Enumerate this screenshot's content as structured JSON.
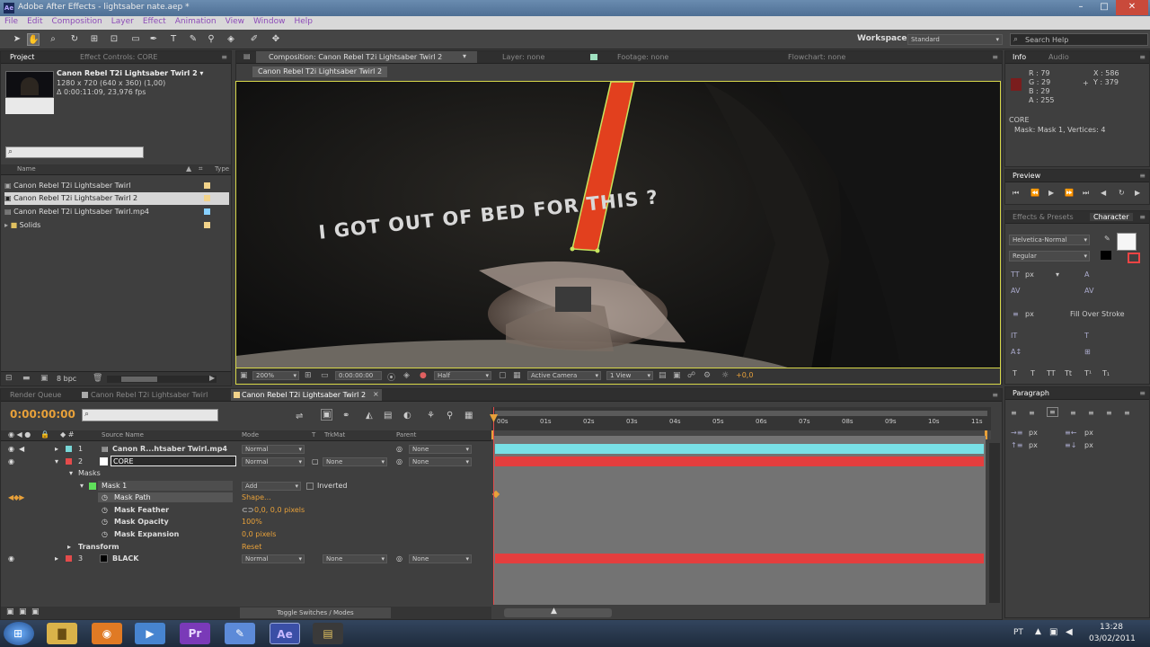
{
  "window": {
    "title": "Adobe After Effects - lightsaber nate.aep *",
    "app_icon": "Ae",
    "minimize": "–",
    "maximize": "□",
    "close": "✕"
  },
  "menu": [
    "File",
    "Edit",
    "Composition",
    "Layer",
    "Effect",
    "Animation",
    "View",
    "Window",
    "Help"
  ],
  "toolbar": {
    "workspace_label": "Workspace:",
    "workspace_value": "Standard",
    "search_placeholder": "Search Help"
  },
  "project": {
    "tab": "Project",
    "tab2": "Effect Controls: CORE",
    "comp_name": "Canon Rebel T2i Lightsaber Twirl 2 ▾",
    "comp_size": "1280 x 720  (640 x 360) (1,00)",
    "comp_duration": "Δ 0:00:11:09, 23,976 fps",
    "search_placeholder": "",
    "col_name": "Name",
    "col_type": "Type",
    "items": [
      {
        "label": "Canon Rebel T2i Lightsaber Twirl",
        "color": "#f2d38a"
      },
      {
        "label": "Canon Rebel T2i Lightsaber Twirl 2",
        "color": "#f2d38a"
      },
      {
        "label": "Canon Rebel T2i Lightsaber Twirl.mp4",
        "color": "#88d0ff"
      },
      {
        "label": "Solids",
        "color": "#f2d38a"
      }
    ],
    "bpc": "8 bpc"
  },
  "composition": {
    "tab": "Composition: Canon Rebel T2i Lightsaber Twirl 2",
    "tab_other1": "Layer: none",
    "tab_other2": "Footage: none",
    "tab_other3": "Flowchart: none",
    "breadcrumb": "Canon Rebel T2i Lightsaber Twirl 2",
    "shirt_text": "I GOT OUT OF BED FOR THIS ?",
    "zoom": "200%",
    "timecode": "0:00:00:00",
    "resolution": "Half",
    "camera": "Active Camera",
    "view": "1 View",
    "exposure": "+0,0"
  },
  "timeline": {
    "tab_render": "Render Queue",
    "tab_comp1": "Canon Rebel T2i Lightsaber Twirl",
    "tab_comp2": "Canon Rebel T2i Lightsaber Twirl 2",
    "current_time": "0:00:00:00",
    "search_placeholder": "",
    "col_source": "Source Name",
    "col_mode": "Mode",
    "col_t": "T",
    "col_trkmat": "TrkMat",
    "col_parent": "Parent",
    "ruler": [
      "00s",
      "01s",
      "02s",
      "03s",
      "04s",
      "05s",
      "06s",
      "07s",
      "08s",
      "09s",
      "10s",
      "11s"
    ],
    "layers": [
      {
        "num": "1",
        "name": "Canon R...htsaber Twirl.mp4",
        "mode": "Normal",
        "trkmat": "",
        "parent": "None",
        "color": "#78d7d7"
      },
      {
        "num": "2",
        "name": "CORE",
        "mode": "Normal",
        "trkmat": "None",
        "parent": "None",
        "color": "#e44b4b"
      },
      {
        "num": "3",
        "name": "BLACK",
        "mode": "Normal",
        "trkmat": "None",
        "parent": "None",
        "color": "#e44b4b"
      }
    ],
    "masks_label": "Masks",
    "mask_name": "Mask 1",
    "mask_mode": "Add",
    "mask_inverted": "Inverted",
    "mask_path_label": "Mask Path",
    "mask_path_value": "Shape...",
    "mask_feather_label": "Mask Feather",
    "mask_feather_value": "0,0, 0,0 pixels",
    "mask_opacity_label": "Mask Opacity",
    "mask_opacity_value": "100%",
    "mask_expansion_label": "Mask Expansion",
    "mask_expansion_value": "0,0 pixels",
    "transform_label": "Transform",
    "transform_value": "Reset",
    "toggle_label": "Toggle Switches / Modes"
  },
  "info": {
    "tab": "Info",
    "tab2": "Audio",
    "r": "R : 79",
    "g": "G : 29",
    "b": "B : 29",
    "a": "A : 255",
    "x": "X : 586",
    "y": "Y : 379",
    "layer": "CORE",
    "mask_info": "Mask: Mask 1, Vertices: 4",
    "swatch": "#7a1d1d"
  },
  "preview": {
    "tab": "Preview"
  },
  "character": {
    "tab": "Effects & Presets",
    "tab2": "Character",
    "font": "Helvetica-Normal",
    "style": "Regular",
    "px": "px",
    "fill": "Fill Over Stroke"
  },
  "paragraph": {
    "tab": "Paragraph",
    "px": "px"
  },
  "taskbar": {
    "lang": "PT",
    "time": "13:28",
    "date": "03/02/2011"
  }
}
